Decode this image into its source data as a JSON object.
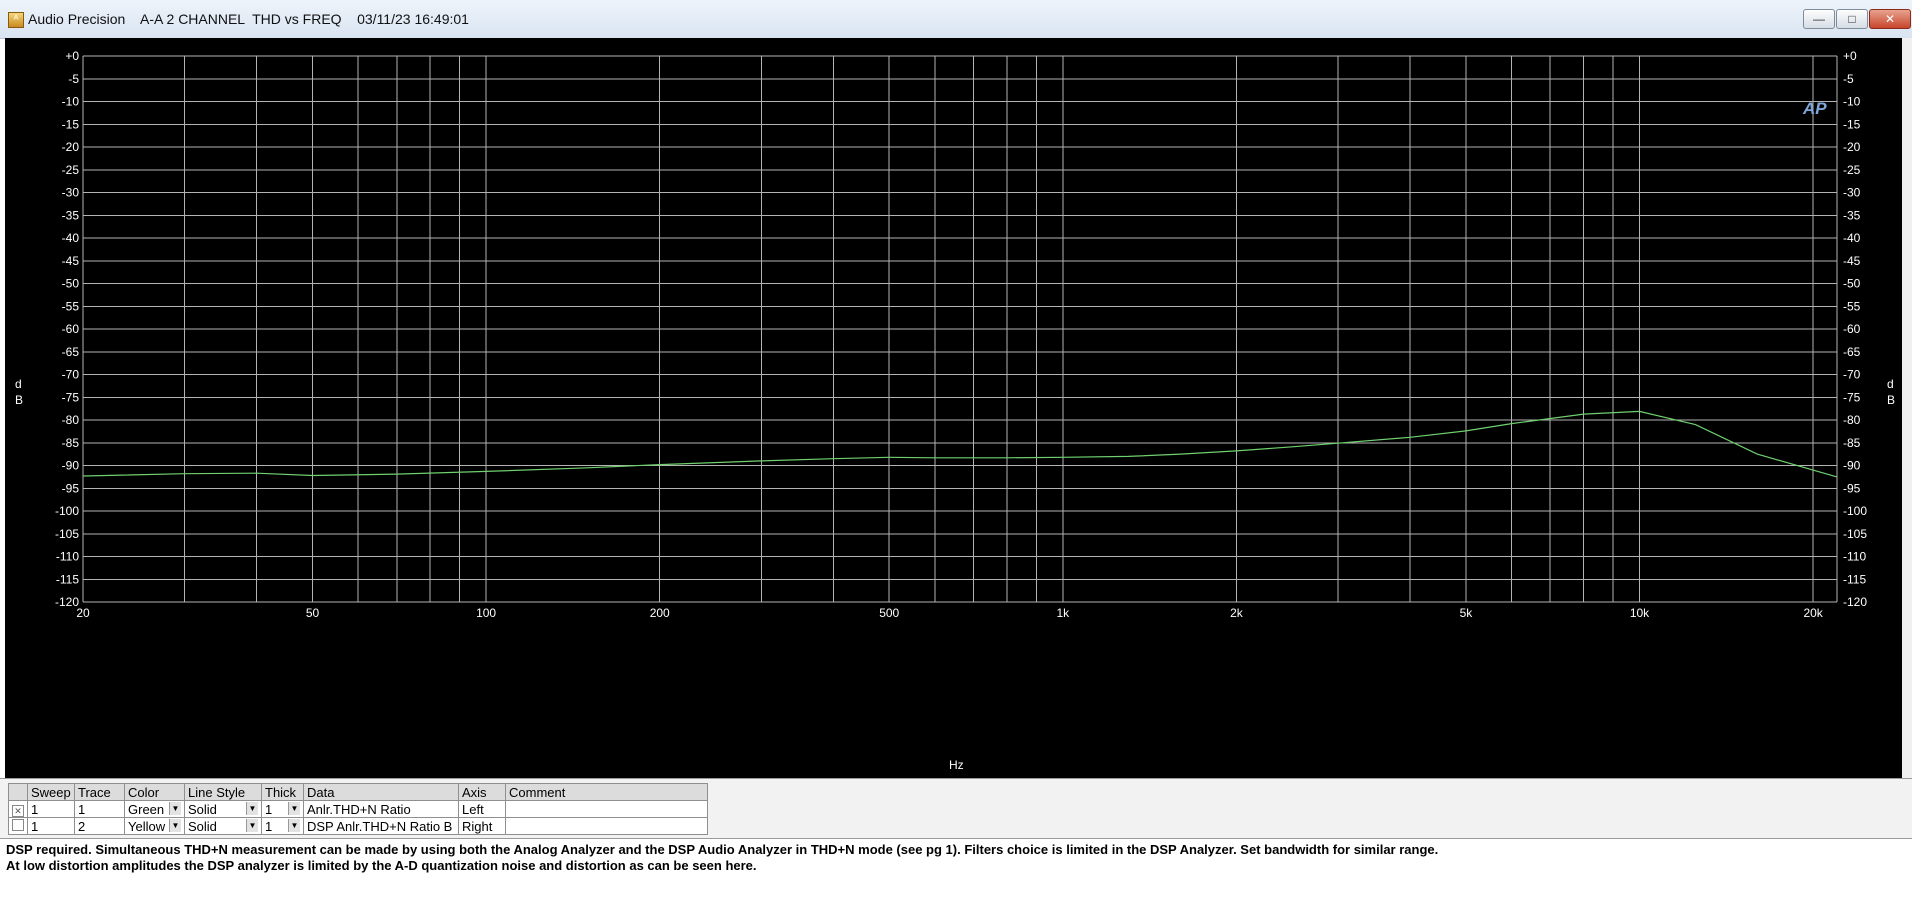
{
  "window": {
    "title": "Audio Precision    A-A 2 CHANNEL  THD vs FREQ    03/11/23 16:49:01",
    "minimize": "—",
    "maximize": "□",
    "close": "✕",
    "app_icon": "ap-window-icon"
  },
  "colors": {
    "graph_background": "#000000",
    "grid": "#b3b3b3",
    "trace_green": "#6fd06f",
    "axis_text": "#ffffff"
  },
  "graph": {
    "logo": "AP",
    "left_unit": [
      "d",
      "B"
    ],
    "right_unit": [
      "d",
      "B"
    ],
    "x_axis_label": "Hz"
  },
  "chart_data": {
    "type": "line",
    "x_scale": "log",
    "xlim": [
      20,
      22000
    ],
    "ylim": [
      -120,
      0
    ],
    "grid": true,
    "x_ticks": [
      {
        "value": 20,
        "label": "20"
      },
      {
        "value": 50,
        "label": "50"
      },
      {
        "value": 100,
        "label": "100"
      },
      {
        "value": 200,
        "label": "200"
      },
      {
        "value": 500,
        "label": "500"
      },
      {
        "value": 1000,
        "label": "1k"
      },
      {
        "value": 2000,
        "label": "2k"
      },
      {
        "value": 5000,
        "label": "5k"
      },
      {
        "value": 10000,
        "label": "10k"
      },
      {
        "value": 20000,
        "label": "20k"
      }
    ],
    "y_ticks_left": [
      "+0",
      "-5",
      "-10",
      "-15",
      "-20",
      "-25",
      "-30",
      "-35",
      "-40",
      "-45",
      "-50",
      "-55",
      "-60",
      "-65",
      "-70",
      "-75",
      "-80",
      "-85",
      "-90",
      "-95",
      "-100",
      "-105",
      "-110",
      "-115",
      "-120"
    ],
    "y_ticks_right": [
      "+0",
      "-5",
      "-10",
      "-15",
      "-20",
      "-25",
      "-30",
      "-35",
      "-40",
      "-45",
      "-50",
      "-55",
      "-60",
      "-65",
      "-70",
      "-75",
      "-80",
      "-85",
      "-90",
      "-95",
      "-100",
      "-105",
      "-110",
      "-115",
      "-120"
    ],
    "xlabel": "Hz",
    "ylabel": "dB",
    "series": [
      {
        "color": "#6fd06f",
        "x": [
          20,
          30,
          40,
          50,
          70,
          100,
          150,
          200,
          300,
          400,
          500,
          600,
          800,
          1000,
          1300,
          1600,
          2000,
          2500,
          3000,
          4000,
          5000,
          6000,
          8000,
          10000,
          12500,
          16000,
          22000
        ],
        "y": [
          -92.3,
          -91.8,
          -91.7,
          -92.2,
          -91.9,
          -91.3,
          -90.5,
          -89.8,
          -89.0,
          -88.5,
          -88.2,
          -88.3,
          -88.3,
          -88.2,
          -88.0,
          -87.5,
          -86.8,
          -85.9,
          -85.1,
          -83.8,
          -82.4,
          -80.8,
          -78.7,
          -78.1,
          -81.0,
          -87.5,
          -92.5
        ]
      }
    ]
  },
  "trace_table": {
    "headers": [
      "Sweep",
      "Trace",
      "Color",
      "Line Style",
      "Thick",
      "Data",
      "Axis",
      "Comment"
    ],
    "rows": [
      {
        "checked": "✕",
        "sweep": "1",
        "trace": "1",
        "color": "Green",
        "line_style": "Solid",
        "thick": "1",
        "data": "Anlr.THD+N Ratio",
        "axis": "Left",
        "comment": ""
      },
      {
        "checked": "",
        "sweep": "1",
        "trace": "2",
        "color": "Yellow",
        "line_style": "Solid",
        "thick": "1",
        "data": "DSP Anlr.THD+N Ratio B",
        "axis": "Right",
        "comment": ""
      }
    ]
  },
  "notes": {
    "line1": "DSP required.  Simultaneous THD+N measurement can be made by using both the Analog Analyzer and the DSP Audio Analyzer in THD+N mode (see pg 1).  Filters choice is limited in the DSP Analyzer.  Set bandwidth for similar range.",
    "line2": "At low distortion amplitudes the DSP analyzer is limited by the A-D quantization noise and distortion as can be seen here."
  }
}
